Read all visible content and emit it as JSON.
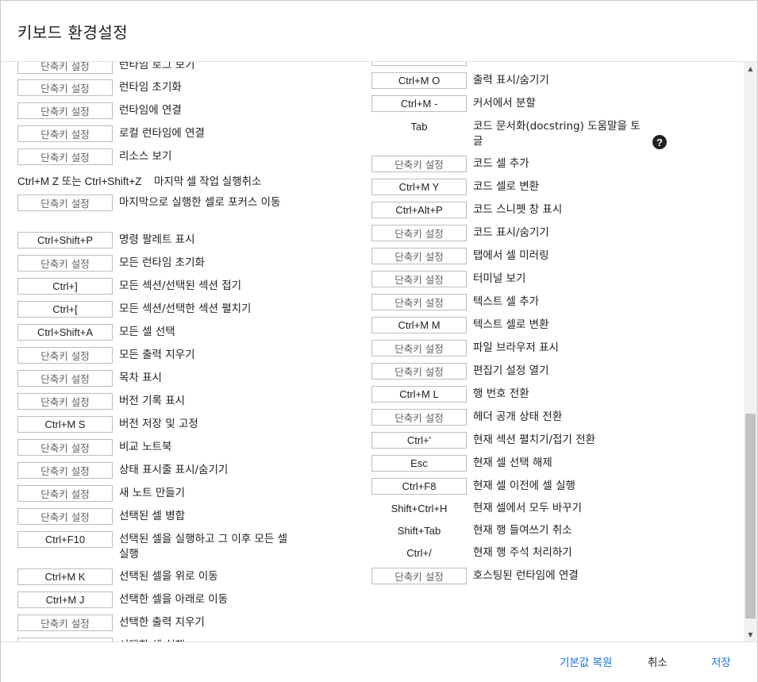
{
  "dialog": {
    "title": "키보드 환경설정"
  },
  "footer": {
    "restore_label": "기본값 복원",
    "cancel_label": "취소",
    "save_label": "저장"
  },
  "help_icon": {
    "glyph": "?"
  },
  "shortcuts_left": [
    {
      "key": "단축키 설정",
      "set": false,
      "label": "런타임 로그 보기"
    },
    {
      "key": "단축키 설정",
      "set": false,
      "label": "런타임 초기화"
    },
    {
      "key": "단축키 설정",
      "set": false,
      "label": "런타임에 연결"
    },
    {
      "key": "단축키 설정",
      "set": false,
      "label": "로컬 런타임에 연결"
    },
    {
      "key": "단축키 설정",
      "set": false,
      "label": "리소스 보기"
    },
    {
      "key": "Ctrl+M Z 또는 Ctrl+Shift+Z",
      "set": true,
      "inline": true,
      "label": "마지막 셀 작업 실행취소"
    },
    {
      "key": "단축키 설정",
      "set": false,
      "label": "마지막으로 실행한 셀로 포커스 이동"
    },
    {
      "key": "Ctrl+Shift+P",
      "set": true,
      "label": "명령 팔레트 표시"
    },
    {
      "key": "단축키 설정",
      "set": false,
      "label": "모든 런타임 초기화"
    },
    {
      "key": "Ctrl+]",
      "set": true,
      "label": "모든 섹션/선택된 섹션 접기"
    },
    {
      "key": "Ctrl+[",
      "set": true,
      "label": "모든 섹션/선택한 섹션 펼치기"
    },
    {
      "key": "Ctrl+Shift+A",
      "set": true,
      "label": "모든 셀 선택"
    },
    {
      "key": "단축키 설정",
      "set": false,
      "label": "모든 출력 지우기"
    },
    {
      "key": "단축키 설정",
      "set": false,
      "label": "목차 표시"
    },
    {
      "key": "단축키 설정",
      "set": false,
      "label": "버전 기록 표시"
    },
    {
      "key": "Ctrl+M S",
      "set": true,
      "label": "버전 저장 및 고정"
    },
    {
      "key": "단축키 설정",
      "set": false,
      "label": "비교 노트북"
    },
    {
      "key": "단축키 설정",
      "set": false,
      "label": "상태 표시줄 표시/숨기기"
    },
    {
      "key": "단축키 설정",
      "set": false,
      "label": "새 노트 만들기"
    },
    {
      "key": "단축키 설정",
      "set": false,
      "label": "선택된 셀 병합"
    },
    {
      "key": "Ctrl+F10",
      "set": true,
      "label": "선택된 셀을 실행하고 그 이후 모든 셀 실행"
    },
    {
      "key": "Ctrl+M K",
      "set": true,
      "label": "선택된 셀을 위로 이동"
    },
    {
      "key": "Ctrl+M J",
      "set": true,
      "label": "선택한 셀을 아래로 이동"
    },
    {
      "key": "단축키 설정",
      "set": false,
      "label": "선택한 출력 지우기"
    },
    {
      "key": "단축키 설정",
      "set": false,
      "label": "선택한 셀 실행"
    }
  ],
  "shortcuts_right": [
    {
      "key": "",
      "set": true,
      "label": ""
    },
    {
      "key": "Ctrl+M O",
      "set": true,
      "label": "출력 표시/숨기기"
    },
    {
      "key": "Ctrl+M -",
      "set": true,
      "label": "커서에서 분할"
    },
    {
      "key": "Tab",
      "set": true,
      "plain": true,
      "label": "코드 문서화(docstring) 도움말을 토글"
    },
    {
      "key": "단축키 설정",
      "set": false,
      "label": "코드 셀 추가"
    },
    {
      "key": "Ctrl+M Y",
      "set": true,
      "label": "코드 셀로 변환"
    },
    {
      "key": "Ctrl+Alt+P",
      "set": true,
      "label": "코드 스니펫 창 표시"
    },
    {
      "key": "단축키 설정",
      "set": false,
      "label": "코드 표시/숨기기"
    },
    {
      "key": "단축키 설정",
      "set": false,
      "label": "탭에서 셀 미러링"
    },
    {
      "key": "단축키 설정",
      "set": false,
      "label": "터미널 보기"
    },
    {
      "key": "단축키 설정",
      "set": false,
      "label": "텍스트 셀 추가"
    },
    {
      "key": "Ctrl+M M",
      "set": true,
      "label": "텍스트 셀로 변환"
    },
    {
      "key": "단축키 설정",
      "set": false,
      "label": "파일 브라우저 표시"
    },
    {
      "key": "단축키 설정",
      "set": false,
      "label": "편집기 설정 열기"
    },
    {
      "key": "Ctrl+M L",
      "set": true,
      "label": "행 번호 전환"
    },
    {
      "key": "단축키 설정",
      "set": false,
      "label": "헤더 공개 상태 전환"
    },
    {
      "key": "Ctrl+'",
      "set": true,
      "label": "현재 섹션 펼치기/접기 전환"
    },
    {
      "key": "Esc",
      "set": true,
      "label": "현재 셀 선택 해제"
    },
    {
      "key": "Ctrl+F8",
      "set": true,
      "label": "현재 셀 이전에 셀 실행"
    },
    {
      "key": "Shift+Ctrl+H",
      "set": true,
      "plain": true,
      "label": "현재 셀에서 모두 바꾸기"
    },
    {
      "key": "Shift+Tab",
      "set": true,
      "plain": true,
      "label": "현재 행 들여쓰기 취소"
    },
    {
      "key": "Ctrl+/",
      "set": true,
      "plain": true,
      "label": "현재 행 주석 처리하기"
    },
    {
      "key": "단축키 설정",
      "set": false,
      "label": "호스팅된 런타임에 연결"
    }
  ]
}
